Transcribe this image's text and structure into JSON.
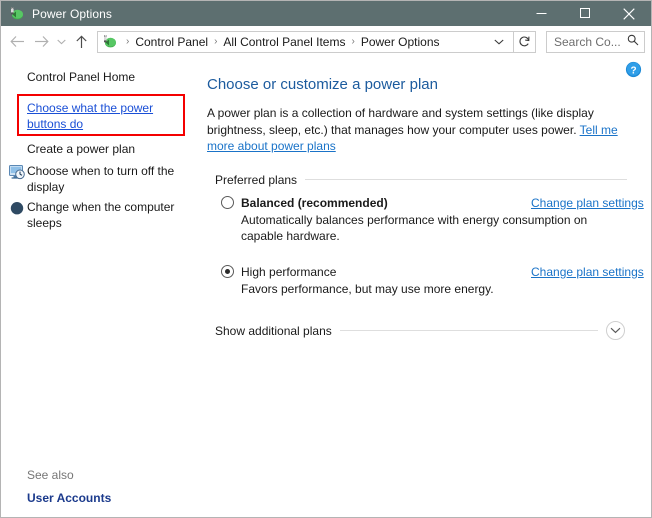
{
  "window": {
    "title": "Power Options",
    "icon": "power-plug-icon",
    "controls": {
      "minimize": "minimize-icon",
      "maximize": "maximize-icon",
      "close": "close-icon"
    },
    "titlebar_color": "#5d6f70"
  },
  "addressbar": {
    "back": "back-arrow-icon",
    "forward": "forward-arrow-icon",
    "recent": "chevron-down-icon",
    "up": "up-arrow-icon",
    "breadcrumb_icon": "power-plug-icon",
    "breadcrumbs": [
      "Control Panel",
      "All Control Panel Items",
      "Power Options"
    ],
    "separator": "›",
    "dropdown": "chevron-down-icon",
    "refresh": "refresh-icon",
    "search_placeholder": "Search Co...",
    "search_value": "",
    "search_icon": "magnifier-icon"
  },
  "sidebar": {
    "home_label": "Control Panel Home",
    "items": [
      {
        "label": "Choose what the power buttons do",
        "icon": null,
        "is_link": true,
        "highlighted": true
      },
      {
        "label": "Create a power plan",
        "icon": null,
        "is_link": false,
        "highlighted": false
      },
      {
        "label": "Choose when to turn off the display",
        "icon": "display-clock-icon",
        "is_link": false,
        "highlighted": false
      },
      {
        "label": "Change when the computer sleeps",
        "icon": "sleep-moon-icon",
        "is_link": false,
        "highlighted": false
      }
    ],
    "see_also_label": "See also",
    "see_also_link": "User Accounts",
    "highlight_color": "#f40000"
  },
  "content": {
    "help_icon": "help-question-icon",
    "heading": "Choose or customize a power plan",
    "description_part1": "A power plan is a collection of hardware and system settings (like display brightness, sleep, etc.) that manages how your computer uses power. ",
    "description_link": "Tell me more about power plans",
    "preferred_plans_label": "Preferred plans",
    "plans": [
      {
        "name": "Balanced (recommended)",
        "selected": false,
        "bold": true,
        "description": "Automatically balances performance with energy consumption on capable hardware.",
        "link": "Change plan settings"
      },
      {
        "name": "High performance",
        "selected": true,
        "bold": false,
        "description": "Favors performance, but may use more energy.",
        "link": "Change plan settings"
      }
    ],
    "show_additional_label": "Show additional plans",
    "show_additional_icon": "chevron-down-circle-icon",
    "link_color": "#1a73c8",
    "heading_color": "#1c5b9e"
  }
}
